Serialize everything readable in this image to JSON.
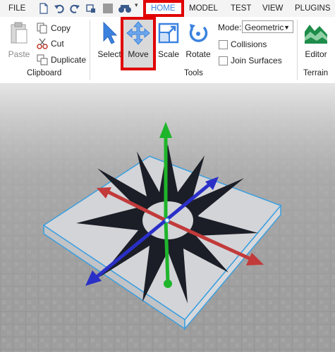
{
  "menu": {
    "file": "FILE",
    "home": "HOME",
    "model": "MODEL",
    "test": "TEST",
    "view": "VIEW",
    "plugins": "PLUGINS"
  },
  "clipboard": {
    "paste": "Paste",
    "copy": "Copy",
    "cut": "Cut",
    "duplicate": "Duplicate",
    "group_label": "Clipboard"
  },
  "tools": {
    "select": "Select",
    "move": "Move",
    "scale": "Scale",
    "rotate": "Rotate",
    "mode_label": "Mode:",
    "mode_value": "Geometric",
    "collisions": "Collisions",
    "join_surfaces": "Join Surfaces",
    "group_label": "Tools"
  },
  "terrain": {
    "editor": "Editor",
    "group_label": "Terrain"
  },
  "colors": {
    "highlight": "#e00000",
    "accent_blue": "#3b82e0",
    "active_tab": "#d9d9d9"
  },
  "icons": [
    "file-icon",
    "undo-icon",
    "redo-icon",
    "screenshot-icon",
    "stop-icon",
    "binoculars-icon",
    "paste-icon",
    "copy-icon",
    "cut-icon",
    "duplicate-icon",
    "select-cursor-icon",
    "move-arrows-icon",
    "scale-icon",
    "rotate-icon",
    "terrain-editor-icon"
  ]
}
